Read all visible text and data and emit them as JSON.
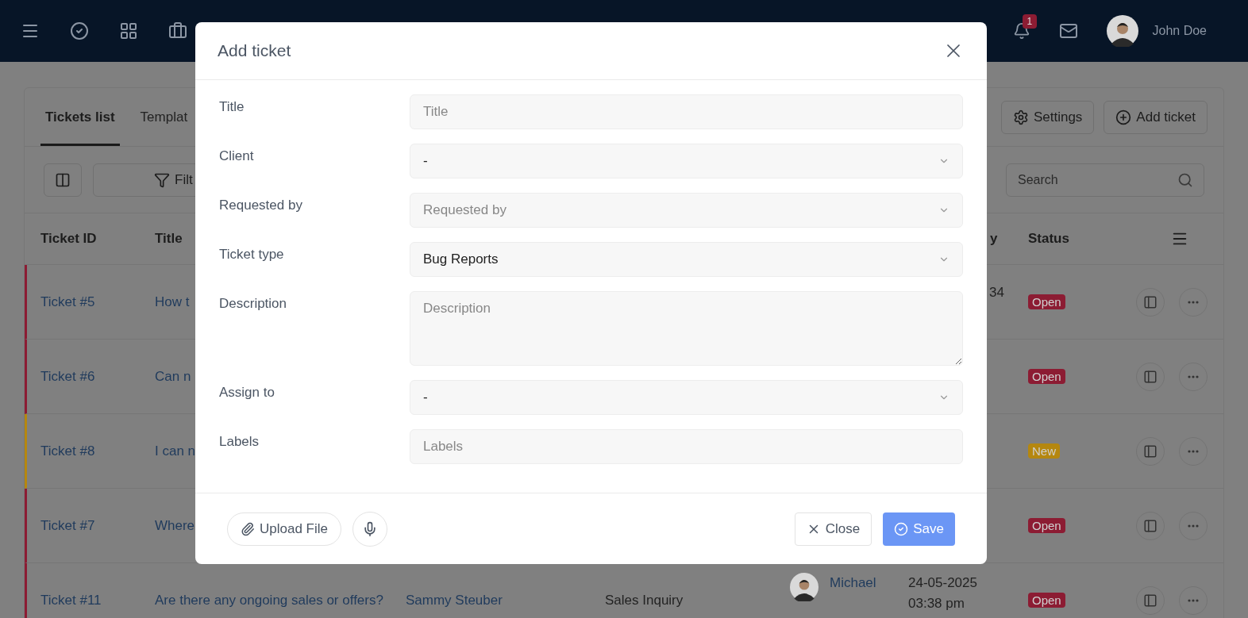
{
  "topbar": {
    "notifications_badge": "1",
    "user_name": "John Doe"
  },
  "tabs": [
    {
      "label": "Tickets list",
      "selected": true
    },
    {
      "label": "Templat",
      "selected": false
    }
  ],
  "header_buttons": [
    "Settings",
    "Add ticket"
  ],
  "toolbar": {
    "filter_label": "Filt",
    "search_placeholder": "Search"
  },
  "table": {
    "columns": [
      "Ticket ID",
      "Title",
      "",
      "",
      "",
      "y",
      "Status"
    ],
    "rows": [
      {
        "ticket_id": "Ticket #5",
        "title": "How t",
        "client": "",
        "type": "",
        "assignee": "",
        "date": [
          "34"
        ],
        "status": {
          "label": "Open",
          "color": "#8c1c33"
        }
      },
      {
        "ticket_id": "Ticket #6",
        "title": "Can n",
        "client": "",
        "type": "",
        "assignee": "",
        "date": [],
        "status": {
          "label": "Open",
          "color": "#8c1c33"
        }
      },
      {
        "ticket_id": "Ticket #8",
        "title": "I can n",
        "client": "",
        "type": "",
        "assignee": "",
        "date": [],
        "status": {
          "label": "New",
          "color": "#b5870f"
        }
      },
      {
        "ticket_id": "Ticket #7",
        "title": "Where",
        "client": "",
        "type": "",
        "assignee": "",
        "date": [],
        "status": {
          "label": "Open",
          "color": "#8c1c33"
        }
      },
      {
        "ticket_id": "Ticket #11",
        "title": "Are there any ongoing sales or offers?",
        "client": "Sammy Steuber",
        "type": "Sales Inquiry",
        "assignee": "Michael",
        "date": [
          "24-05-2025",
          "03:38 pm"
        ],
        "status": {
          "label": "Open",
          "color": "#8c1c33"
        }
      }
    ]
  },
  "modal": {
    "title": "Add ticket",
    "fields": [
      {
        "kind": "text",
        "label": "Title",
        "placeholder": "Title"
      },
      {
        "kind": "select",
        "label": "Client",
        "value": "-"
      },
      {
        "kind": "select",
        "label": "Requested by",
        "placeholder": "Requested by"
      },
      {
        "kind": "select",
        "label": "Ticket type",
        "value": "Bug Reports"
      },
      {
        "kind": "textarea",
        "label": "Description",
        "placeholder": "Description"
      },
      {
        "kind": "select",
        "label": "Assign to",
        "value": "-"
      },
      {
        "kind": "text",
        "label": "Labels",
        "placeholder": "Labels"
      }
    ],
    "upload_label": "Upload File",
    "close_label": "Close",
    "save_label": "Save"
  }
}
